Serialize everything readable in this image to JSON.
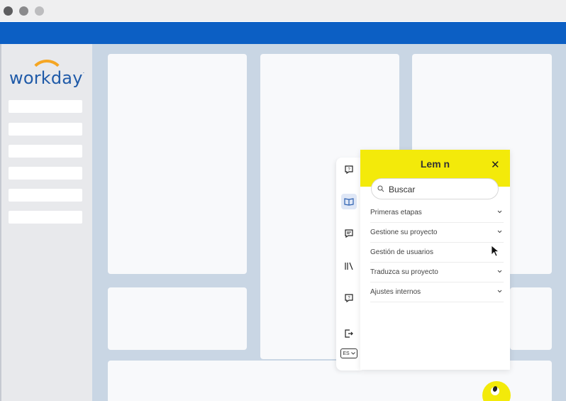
{
  "window": {
    "controls": [
      "close",
      "minimize",
      "maximize"
    ]
  },
  "sidebar": {
    "logo_text": "workday",
    "logo_mark": "."
  },
  "lemon_panel": {
    "title": "Lem  n",
    "close_glyph": "✕",
    "search": {
      "placeholder": "Buscar",
      "value": ""
    },
    "menu_items": [
      {
        "label": "Primeras etapas",
        "has_chevron": true
      },
      {
        "label": "Gestione su proyecto",
        "has_chevron": true
      },
      {
        "label": "Gestión de usuarios",
        "has_chevron": false
      },
      {
        "label": "Traduzca su proyecto",
        "has_chevron": true
      },
      {
        "label": "Ajustes internos",
        "has_chevron": true
      }
    ],
    "language": "ES"
  },
  "icons": {
    "rail": [
      "help-icon",
      "book-icon",
      "chat-icon",
      "library-icon",
      "help-icon",
      "logout-icon"
    ]
  },
  "colors": {
    "brand_blue": "#0c5fc4",
    "lemon_yellow": "#f3ea0a",
    "workday_orange": "#f5a623",
    "workday_blue": "#1f5aa8"
  }
}
